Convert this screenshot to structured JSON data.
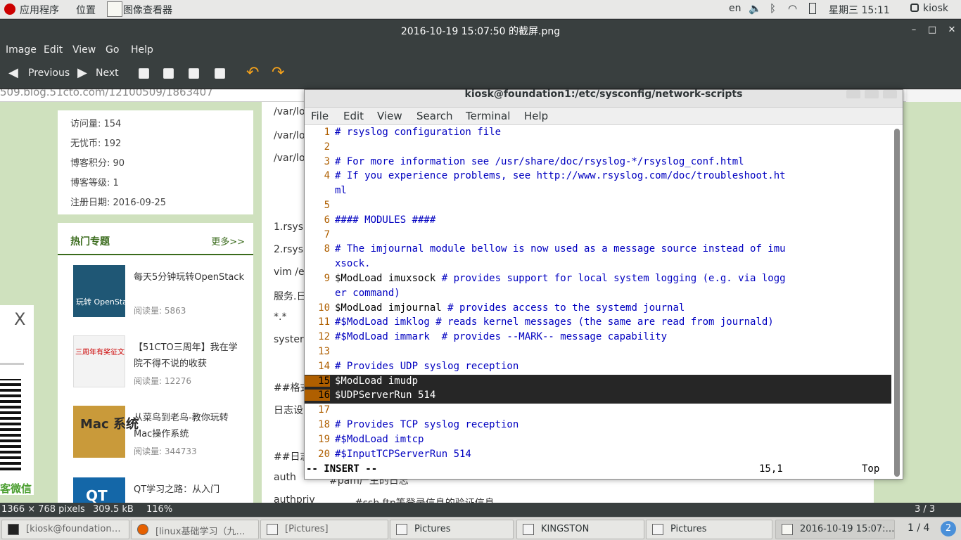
{
  "gnome_bar": {
    "applications": "应用程序",
    "places": "位置",
    "app_name": "图像查看器",
    "lang": "en",
    "datetime": "星期三 15:11",
    "user": "kiosk"
  },
  "window": {
    "title": "2016-10-19 15:07:50 的截屏.png",
    "menu": [
      "Image",
      "Edit",
      "View",
      "Go",
      "Help"
    ]
  },
  "toolbar": {
    "previous": "Previous",
    "next": "Next"
  },
  "viewer_content": {
    "url": "509.blog.51cto.com/12100509/1863407",
    "stats": [
      "访问量: 154",
      "无忧币: 192",
      "博客积分: 90",
      "博客等级: 1",
      "注册日期: 2016-09-25"
    ],
    "hot_title": "热门专题",
    "hot_more": "更多>>",
    "items": [
      {
        "title": "每天5分钟玩转OpenStack",
        "reads": "阅读量: 5863",
        "thumb_text": "玩转 OpenStack"
      },
      {
        "title": "【51CTO三周年】我在学院不得不说的收获",
        "reads": "阅读量: 12276",
        "thumb_text": "三周年有奖征文"
      },
      {
        "title": "从菜鸟到老鸟-教你玩转Mac操作系统",
        "reads": "阅读量: 344733",
        "thumb_text": "Mac 系统"
      },
      {
        "title": "QT学习之路：从入门",
        "reads": "",
        "thumb_text": "QT"
      }
    ],
    "mid_lines": [
      "/var/lo",
      "/var/lo",
      "/var/lo",
      "1.rsys",
      "2.rsys",
      "vim /e",
      "服务.日",
      "*.*",
      "syster",
      "##格式",
      "日志设",
      "##日志",
      "auth",
      "authpriv"
    ],
    "mid_lines_right": [
      "#pam产生的日志",
      "#ssh,ftp等登录信息的验证信息"
    ],
    "popup_close": "X",
    "popup_text": "客微信"
  },
  "terminal": {
    "title": "kiosk@foundation1:/etc/sysconfig/network-scripts",
    "menu": [
      "File",
      "Edit",
      "View",
      "Search",
      "Terminal",
      "Help"
    ],
    "lines": [
      {
        "n": "1",
        "text": "# rsyslog configuration file",
        "kind": "comment"
      },
      {
        "n": "2",
        "text": "",
        "kind": "code"
      },
      {
        "n": "3",
        "text": "# For more information see /usr/share/doc/rsyslog-*/rsyslog_conf.html",
        "kind": "comment"
      },
      {
        "n": "4",
        "text": "# If you experience problems, see http://www.rsyslog.com/doc/troubleshoot.ht",
        "kind": "comment"
      },
      {
        "n": "",
        "text": "ml",
        "kind": "comment"
      },
      {
        "n": "5",
        "text": "",
        "kind": "code"
      },
      {
        "n": "6",
        "text": "#### MODULES ####",
        "kind": "comment"
      },
      {
        "n": "7",
        "text": "",
        "kind": "code"
      },
      {
        "n": "8",
        "text": "# The imjournal module bellow is now used as a message source instead of imu",
        "kind": "comment"
      },
      {
        "n": "",
        "text": "xsock.",
        "kind": "comment"
      },
      {
        "n": "9",
        "text": "$ModLoad imuxsock",
        "comment": " # provides support for local system logging (e.g. via logg",
        "kind": "mixed"
      },
      {
        "n": "",
        "text": "er command)",
        "kind": "comment"
      },
      {
        "n": "10",
        "text": "$ModLoad imjournal",
        "comment": " # provides access to the systemd journal",
        "kind": "mixed"
      },
      {
        "n": "11",
        "text": "#$ModLoad imklog # reads kernel messages (the same are read from journald)",
        "kind": "comment"
      },
      {
        "n": "12",
        "text": "#$ModLoad immark  # provides --MARK-- message capability",
        "kind": "comment"
      },
      {
        "n": "13",
        "text": "",
        "kind": "code"
      },
      {
        "n": "14",
        "text": "# Provides UDP syslog reception",
        "kind": "comment"
      },
      {
        "n": "15",
        "text": "$ModLoad imudp",
        "kind": "selected"
      },
      {
        "n": "16",
        "text": "$UDPServerRun 514",
        "kind": "selected"
      },
      {
        "n": "17",
        "text": "",
        "kind": "code"
      },
      {
        "n": "18",
        "text": "# Provides TCP syslog reception",
        "kind": "comment"
      },
      {
        "n": "19",
        "text": "#$ModLoad imtcp",
        "kind": "comment"
      },
      {
        "n": "20",
        "text": "#$InputTCPServerRun 514",
        "kind": "comment"
      }
    ],
    "mode": "-- INSERT --",
    "position": "15,1",
    "scroll": "Top"
  },
  "status": {
    "dims": "1366 × 768 pixels",
    "size": "309.5 kB",
    "zoom": "116%",
    "page": "3 / 3"
  },
  "taskbar": {
    "items": [
      "[kiosk@foundation…",
      "[linux基础学习（九…",
      "[Pictures]",
      "Pictures",
      "KINGSTON",
      "Pictures",
      "2016-10-19 15:07:…"
    ],
    "workspace": "1 / 4",
    "notif": "2"
  }
}
